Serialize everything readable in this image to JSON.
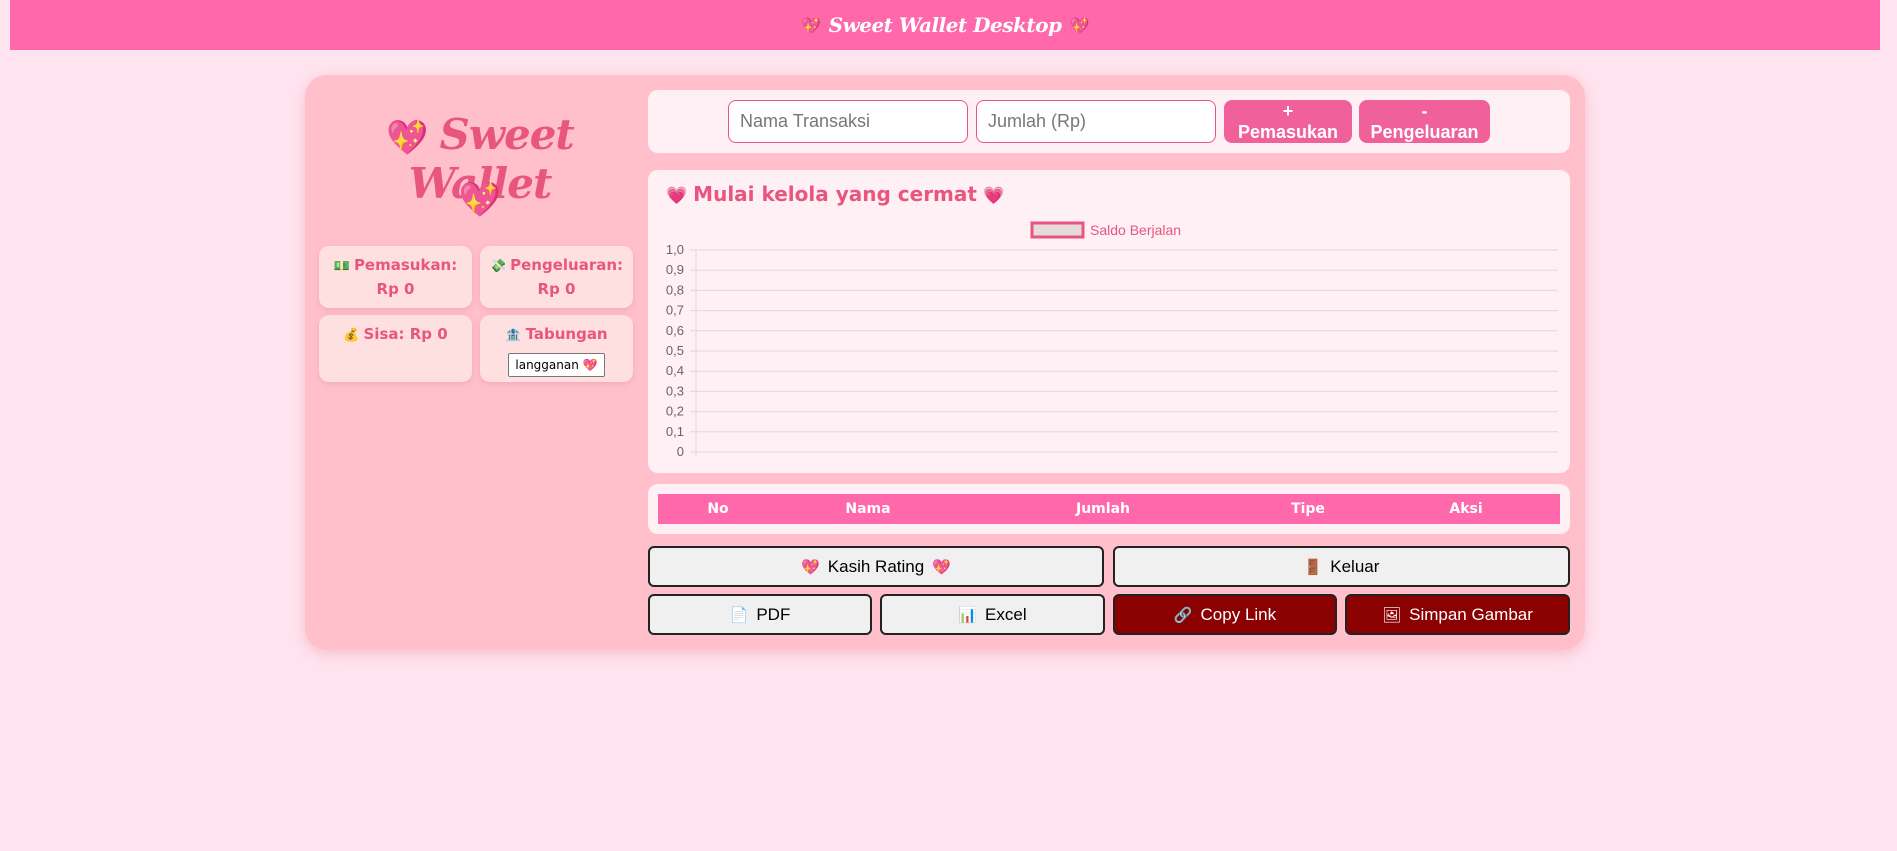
{
  "topbar": {
    "title": "Sweet Wallet Desktop",
    "heart_icon": "heart-icon"
  },
  "sidebar": {
    "brand": "Sweet Wallet",
    "cards": {
      "income": {
        "label": "Pemasukan:",
        "value": "Rp 0",
        "icon": "money-icon"
      },
      "expense": {
        "label": "Pengeluaran:",
        "value": "Rp 0",
        "icon": "money-fly-icon"
      },
      "balance": {
        "label": "Sisa: Rp 0",
        "icon": "money-bag-icon"
      },
      "savings": {
        "label": "Tabungan",
        "button": "langganan",
        "icon": "bank-icon"
      }
    }
  },
  "form": {
    "name_placeholder": "Nama Transaksi",
    "amount_placeholder": "Jumlah (Rp)",
    "income_button": "+ Pemasukan",
    "expense_button": "- Pengeluaran"
  },
  "chart_header": {
    "title": "Mulai kelola yang cermat"
  },
  "chart_data": {
    "type": "line",
    "series": [
      {
        "name": "Saldo Berjalan",
        "values": []
      }
    ],
    "yticks": [
      "0",
      "0,1",
      "0,2",
      "0,3",
      "0,4",
      "0,5",
      "0,6",
      "0,7",
      "0,8",
      "0,9",
      "1,0"
    ],
    "ylim": [
      0,
      1
    ],
    "grid": true,
    "legend": "top-center",
    "colors": {
      "line": "#e8557f",
      "grid": "#e6d4da",
      "tick": "#666666"
    }
  },
  "table": {
    "headers": [
      "No",
      "Nama",
      "Jumlah",
      "Tipe",
      "Aksi"
    ]
  },
  "actions": {
    "rating": "Kasih Rating",
    "logout": "Keluar",
    "pdf": "PDF",
    "excel": "Excel",
    "copy_link": "Copy Link",
    "save_image": "Simpan Gambar"
  },
  "colors": {
    "accent": "#ff69ac",
    "brand_text": "#e8557f",
    "panel": "#ffc0cb",
    "dark_button": "#8b0000"
  }
}
